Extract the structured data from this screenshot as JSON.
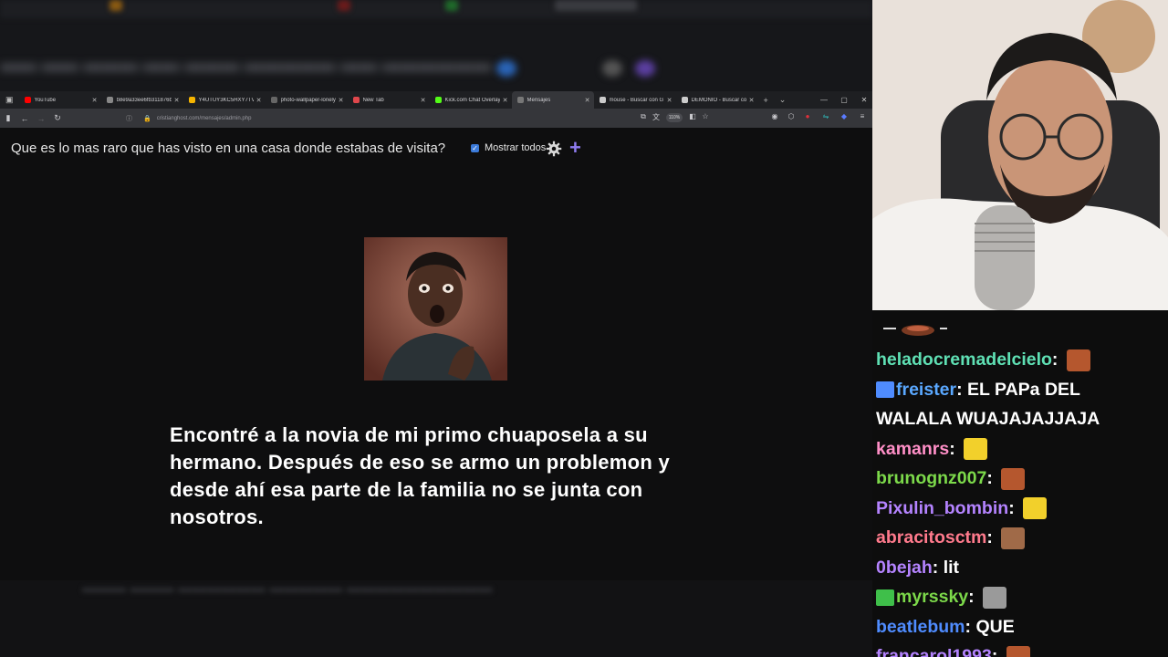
{
  "browser": {
    "tabs": [
      {
        "label": "YouTube",
        "color": "#ff0000",
        "active": false
      },
      {
        "label": "b8e9a33ee6fb311876b73",
        "color": "#888888",
        "active": false
      },
      {
        "label": "Y4UTUY3KC5HXY7TV",
        "color": "#f5b400",
        "active": false
      },
      {
        "label": "photo-wallpaper-lonely-a",
        "color": "#666666",
        "active": false
      },
      {
        "label": "New Tab",
        "color": "#e0474c",
        "active": false
      },
      {
        "label": "Kick.com Chat Overlay",
        "color": "#53fc18",
        "active": false
      },
      {
        "label": "Mensajes",
        "color": "#777777",
        "active": true
      },
      {
        "label": "mouse - Buscar con G",
        "color": "#cccccc",
        "active": false
      },
      {
        "label": "DEMONIO - Buscar co",
        "color": "#cccccc",
        "active": false
      }
    ],
    "url": "cristianghost.com/mensajes/admin.php",
    "zoom": "110%"
  },
  "page": {
    "question": "Que es lo mas raro que has visto en una casa donde estabas de visita?",
    "show_all_label": "Mostrar todos",
    "show_all_checked": true,
    "message": "Encontré a la novia de mi primo chuaposela a su hermano. Después de eso se armo un problemon y desde ahí esa parte de la familia no se junta con nosotros."
  },
  "chat": {
    "messages": [
      {
        "user": "heladocremadelcielo",
        "color": "#5fe0b4",
        "text": "",
        "emote": "#b5572e"
      },
      {
        "user": "freister",
        "color": "#5aa8ff",
        "text": "EL PAPa DEL",
        "badge": "list"
      },
      {
        "user": "",
        "color": "#ffffff",
        "text": "WALALA WUAJAJAJJAJA"
      },
      {
        "user": "kamanrs",
        "color": "#ff8fc7",
        "text": "",
        "emote": "#f2d02b"
      },
      {
        "user": "brunognz007",
        "color": "#7cd94a",
        "text": "",
        "emote": "#b5572e"
      },
      {
        "user": "Pixulin_bombin",
        "color": "#b483ff",
        "text": "",
        "emote": "#f2d02b"
      },
      {
        "user": "abracitosctm",
        "color": "#ff7a8c",
        "text": "",
        "emote": "#a06a48"
      },
      {
        "user": "0bejah",
        "color": "#b483ff",
        "text": "lit"
      },
      {
        "user": "myrssky",
        "color": "#7cd94a",
        "text": "",
        "emote": "#9a9a9a",
        "badge": "1st"
      },
      {
        "user": "beatlebum",
        "color": "#4f8cff",
        "text": "QUE"
      },
      {
        "user": "francarol1993",
        "color": "#b483ff",
        "text": "",
        "emote": "#b5572e"
      }
    ]
  }
}
